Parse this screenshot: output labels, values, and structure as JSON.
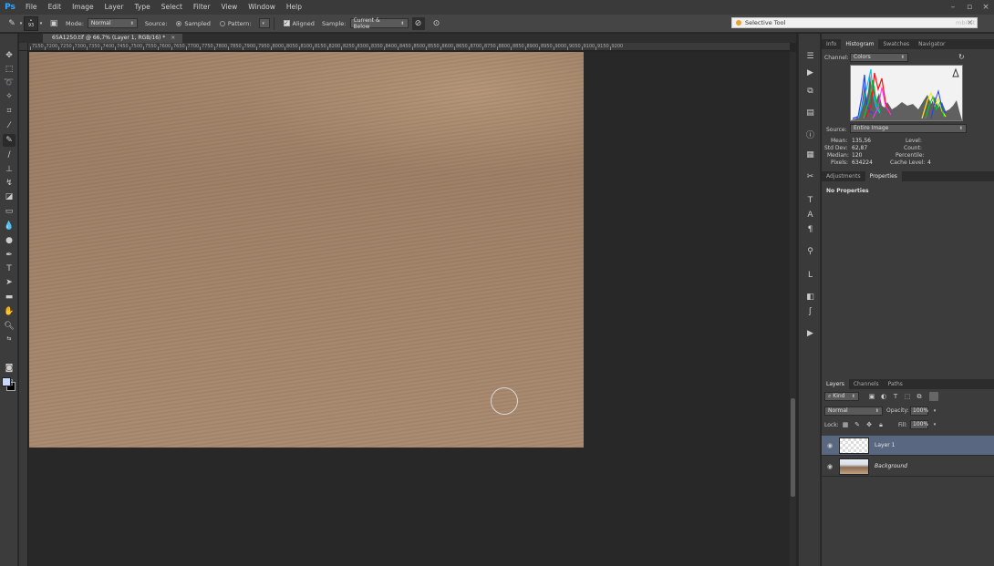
{
  "menu": {
    "logo": "Ps",
    "items": [
      "File",
      "Edit",
      "Image",
      "Layer",
      "Type",
      "Select",
      "Filter",
      "View",
      "Window",
      "Help"
    ]
  },
  "options": {
    "brush_size": "93",
    "mode_label": "Mode:",
    "mode_value": "Normal",
    "source_label": "Source:",
    "sampled_label": "Sampled",
    "pattern_label": "Pattern:",
    "aligned_label": "Aligned",
    "sample_label": "Sample:",
    "sample_value": "Current & Below"
  },
  "selective_tool": {
    "title": "Selective Tool",
    "extra": "mbreit"
  },
  "document": {
    "tab_title": "65A1250.tif @ 66,7% (Layer 1, RGB/16) *",
    "close": "×"
  },
  "ruler_labels": [
    "7150",
    "7200",
    "7250",
    "7300",
    "7350",
    "7400",
    "7450",
    "7500",
    "7550",
    "7600",
    "7650",
    "7700",
    "7750",
    "7800",
    "7850",
    "7900",
    "7950",
    "8000",
    "8050",
    "8100",
    "8150",
    "8200",
    "8250",
    "8300",
    "8350",
    "8400",
    "8450",
    "8500",
    "8550",
    "8600",
    "8650",
    "8700",
    "8750",
    "8800",
    "8850",
    "8900",
    "8950",
    "9000",
    "9050",
    "9100",
    "9150",
    "9200"
  ],
  "panels": {
    "top_tabs": [
      "Info",
      "Histogram",
      "Swatches",
      "Navigator"
    ],
    "top_active": 1,
    "channel_label": "Channel:",
    "channel_value": "Colors",
    "source_label": "Source:",
    "source_value": "Entire Image",
    "stats_left": [
      {
        "label": "Mean:",
        "value": "135,56"
      },
      {
        "label": "Std Dev:",
        "value": "62,87"
      },
      {
        "label": "Median:",
        "value": "120"
      },
      {
        "label": "Pixels:",
        "value": "634224"
      }
    ],
    "stats_right": [
      {
        "label": "Level:",
        "value": ""
      },
      {
        "label": "Count:",
        "value": ""
      },
      {
        "label": "Percentile:",
        "value": ""
      },
      {
        "label": "Cache Level:",
        "value": "4"
      }
    ],
    "mid_tabs": [
      "Adjustments",
      "Properties"
    ],
    "mid_active": 1,
    "no_properties": "No Properties"
  },
  "layers": {
    "tabs": [
      "Layers",
      "Channels",
      "Paths"
    ],
    "active_tab": 0,
    "kind_value": "Kind",
    "blend_value": "Normal",
    "opacity_label": "Opacity:",
    "opacity_value": "100%",
    "lock_label": "Lock:",
    "fill_label": "Fill:",
    "fill_value": "100%",
    "items": [
      {
        "name": "Layer 1",
        "selected": true,
        "italic": false
      },
      {
        "name": "Background",
        "selected": false,
        "italic": true
      }
    ]
  },
  "colors": {
    "foreground": "#c8d8ff",
    "background": "#000000",
    "sand": "#a3856a",
    "accent": "#31a8ff"
  }
}
